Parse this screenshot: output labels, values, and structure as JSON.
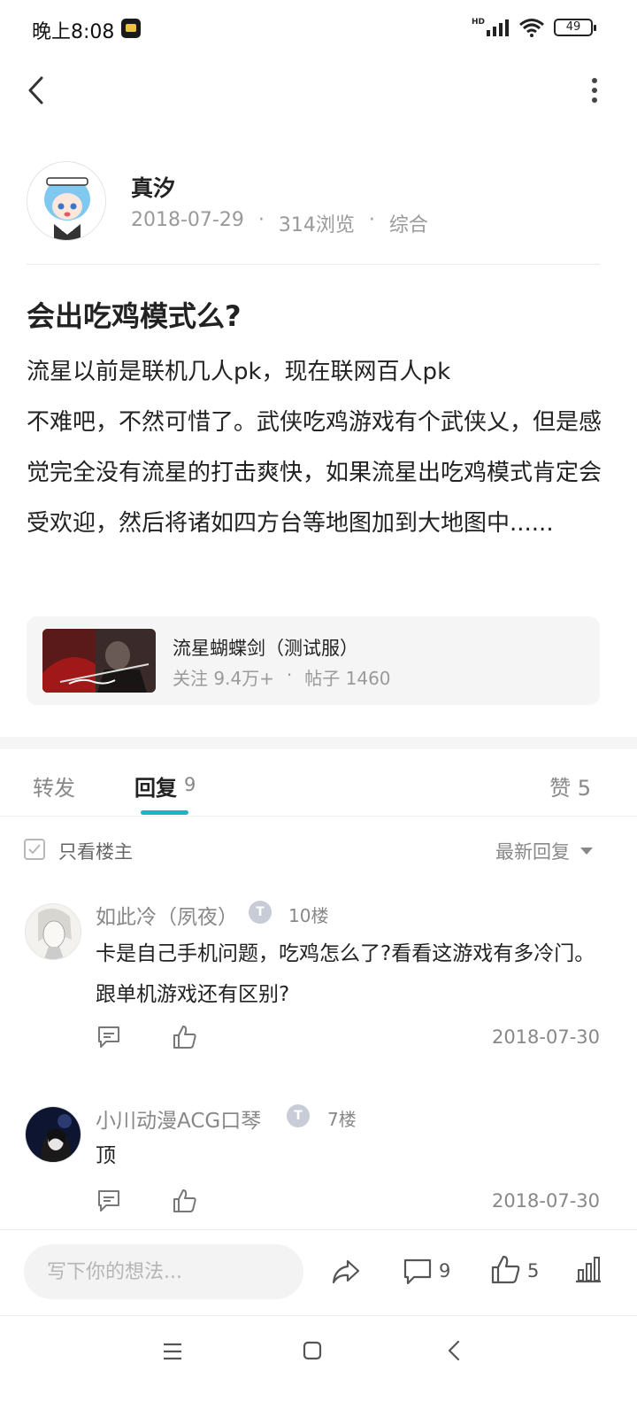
{
  "status_bar": {
    "time": "晚上8:08",
    "network": "HD",
    "battery": "49"
  },
  "author": {
    "name": "真汐",
    "date": "2018-07-29",
    "views": "314浏览",
    "category": "综合",
    "separator": "·"
  },
  "post": {
    "title": "会出吃鸡模式么?",
    "body_lines": [
      "流星以前是联机几人pk，现在联网百人pk",
      "不难吧，不然可惜了。武侠吃鸡游戏有个武侠乂，但是感觉完全没有流星的打击爽快，如果流星出吃鸡模式肯定会受欢迎，然后将诸如四方台等地图加到大地图中......"
    ]
  },
  "forum_card": {
    "name": "流星蝴蝶剑（测试服）",
    "followers": "关注 9.4万+",
    "separator": "·",
    "posts": "帖子 1460"
  },
  "tabs": {
    "forward": "转发",
    "reply": "回复",
    "reply_count": "9",
    "like": "赞 5"
  },
  "filter": {
    "only_owner": "只看楼主",
    "sort": "最新回复"
  },
  "replies": [
    {
      "user": "如此冷（夙夜）",
      "level": "T",
      "floor": "10楼",
      "text": "卡是自己手机问题，吃鸡怎么了?看看这游戏有多冷门。跟单机游戏还有区别?",
      "date": "2018-07-30"
    },
    {
      "user": "小川动漫ACG口琴",
      "level": "T",
      "floor": "7楼",
      "text": "顶",
      "date": "2018-07-30"
    }
  ],
  "bottom_bar": {
    "input_placeholder": "写下你的想法...",
    "comment_count": "9",
    "like_count": "5"
  },
  "colors": {
    "accent": "#1bb5c4",
    "muted_text": "#9a9a9a",
    "card_bg": "#f5f5f5"
  },
  "icons": [
    "back-icon",
    "more-icon",
    "checkbox-icon",
    "caret-down-icon",
    "comment-icon",
    "like-icon",
    "share-icon",
    "stats-icon",
    "menu-icon",
    "home-icon",
    "nav-back-icon"
  ]
}
